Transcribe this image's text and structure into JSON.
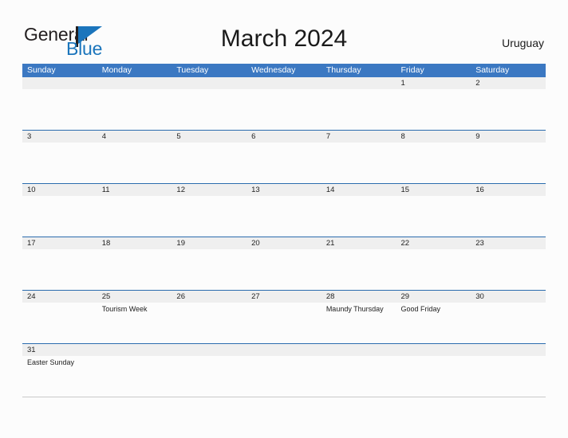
{
  "brand": {
    "word_one": "General",
    "word_two": "Blue",
    "flag_icon": "blue-triangle-flag",
    "dark_color": "#231F20",
    "blue_color": "#1B75BC"
  },
  "header": {
    "title": "March 2024",
    "country": "Uruguay"
  },
  "theme": {
    "header_blue": "#3B78C2",
    "row_divider_blue": "#2B6CAE",
    "date_band_gray": "#EFEFEF",
    "page_background": "#FCFCFC",
    "text_color": "#222222"
  },
  "calendar": {
    "weekdays": [
      "Sunday",
      "Monday",
      "Tuesday",
      "Wednesday",
      "Thursday",
      "Friday",
      "Saturday"
    ],
    "weeks": [
      {
        "days": [
          {
            "date": "",
            "events": []
          },
          {
            "date": "",
            "events": []
          },
          {
            "date": "",
            "events": []
          },
          {
            "date": "",
            "events": []
          },
          {
            "date": "",
            "events": []
          },
          {
            "date": "1",
            "events": []
          },
          {
            "date": "2",
            "events": []
          }
        ]
      },
      {
        "days": [
          {
            "date": "3",
            "events": []
          },
          {
            "date": "4",
            "events": []
          },
          {
            "date": "5",
            "events": []
          },
          {
            "date": "6",
            "events": []
          },
          {
            "date": "7",
            "events": []
          },
          {
            "date": "8",
            "events": []
          },
          {
            "date": "9",
            "events": []
          }
        ]
      },
      {
        "days": [
          {
            "date": "10",
            "events": []
          },
          {
            "date": "11",
            "events": []
          },
          {
            "date": "12",
            "events": []
          },
          {
            "date": "13",
            "events": []
          },
          {
            "date": "14",
            "events": []
          },
          {
            "date": "15",
            "events": []
          },
          {
            "date": "16",
            "events": []
          }
        ]
      },
      {
        "days": [
          {
            "date": "17",
            "events": []
          },
          {
            "date": "18",
            "events": []
          },
          {
            "date": "19",
            "events": []
          },
          {
            "date": "20",
            "events": []
          },
          {
            "date": "21",
            "events": []
          },
          {
            "date": "22",
            "events": []
          },
          {
            "date": "23",
            "events": []
          }
        ]
      },
      {
        "days": [
          {
            "date": "24",
            "events": []
          },
          {
            "date": "25",
            "events": [
              "Tourism Week"
            ]
          },
          {
            "date": "26",
            "events": []
          },
          {
            "date": "27",
            "events": []
          },
          {
            "date": "28",
            "events": [
              "Maundy Thursday"
            ]
          },
          {
            "date": "29",
            "events": [
              "Good Friday"
            ]
          },
          {
            "date": "30",
            "events": []
          }
        ]
      },
      {
        "days": [
          {
            "date": "31",
            "events": [
              "Easter Sunday"
            ]
          },
          {
            "date": "",
            "events": []
          },
          {
            "date": "",
            "events": []
          },
          {
            "date": "",
            "events": []
          },
          {
            "date": "",
            "events": []
          },
          {
            "date": "",
            "events": []
          },
          {
            "date": "",
            "events": []
          }
        ]
      }
    ]
  }
}
